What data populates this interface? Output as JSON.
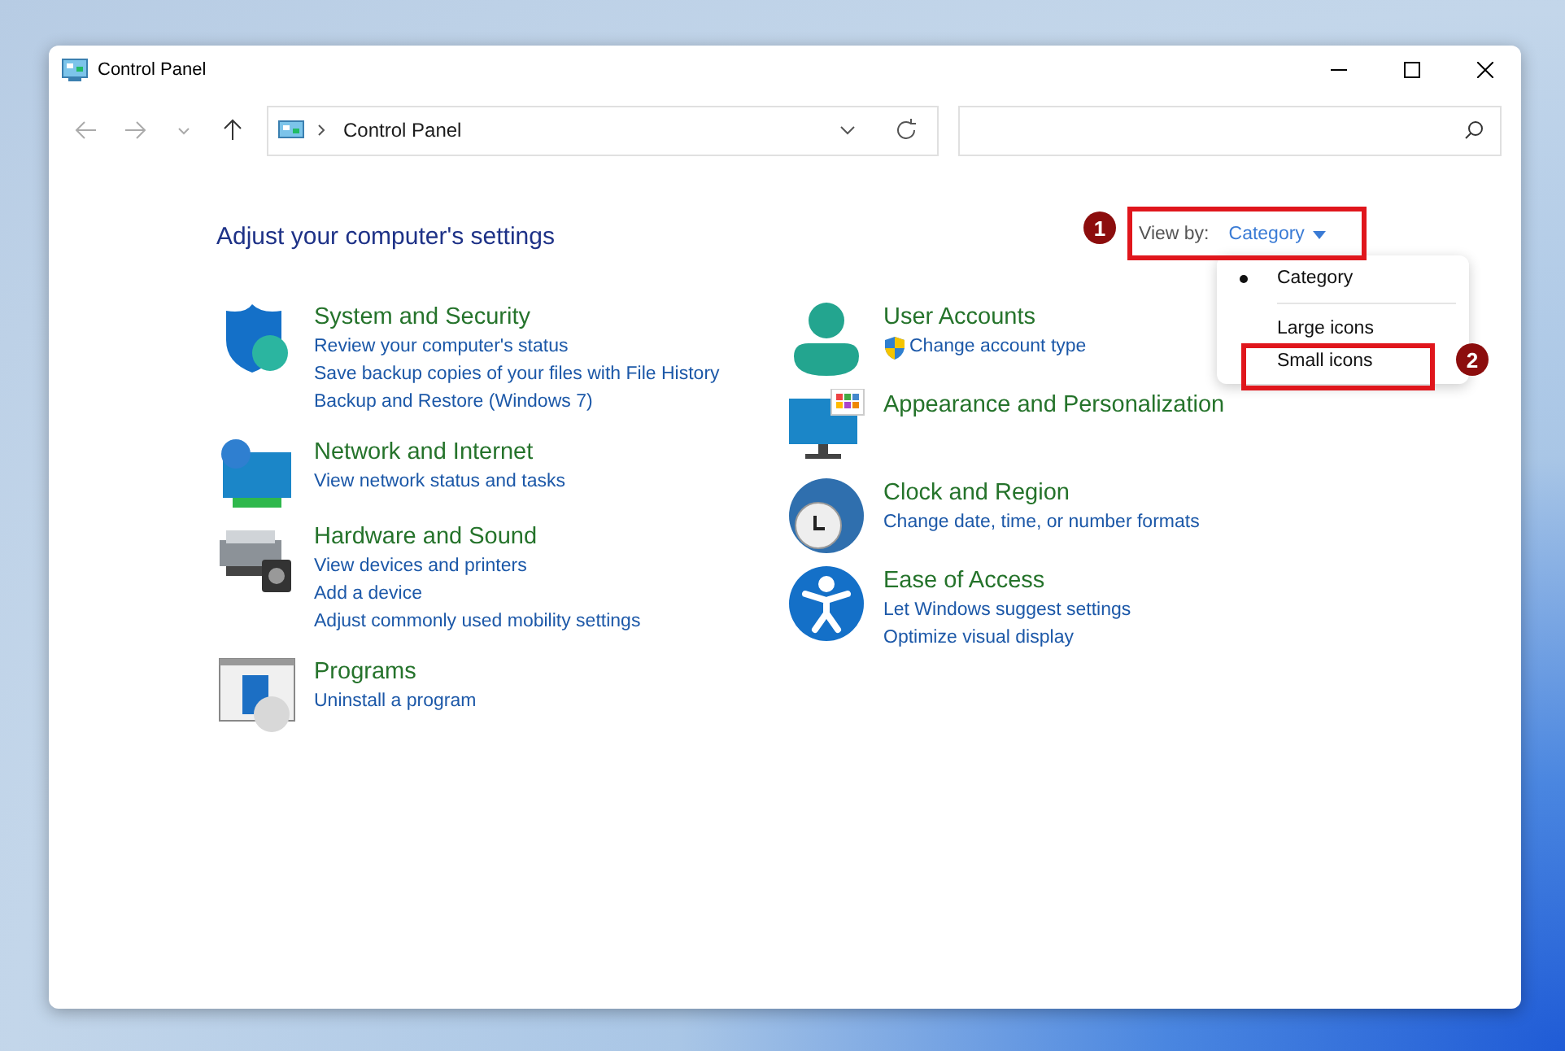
{
  "window": {
    "title": "Control Panel"
  },
  "address_bar": {
    "path": "Control Panel"
  },
  "heading": "Adjust your computer's settings",
  "view_by": {
    "label": "View by:",
    "value": "Category"
  },
  "view_menu": {
    "items": [
      {
        "label": "Category",
        "selected": true
      },
      {
        "label": "Large icons",
        "selected": false
      },
      {
        "label": "Small icons",
        "selected": false
      }
    ]
  },
  "annotations": [
    {
      "number": "1"
    },
    {
      "number": "2"
    }
  ],
  "categories_left": [
    {
      "kind": "security",
      "title": "System and Security",
      "links": [
        {
          "text": "Review your computer's status",
          "uac": false
        },
        {
          "text": "Save backup copies of your files with File History",
          "uac": false
        },
        {
          "text": "Backup and Restore (Windows 7)",
          "uac": false
        }
      ]
    },
    {
      "kind": "network",
      "title": "Network and Internet",
      "links": [
        {
          "text": "View network status and tasks",
          "uac": false
        }
      ]
    },
    {
      "kind": "hardware",
      "title": "Hardware and Sound",
      "links": [
        {
          "text": "View devices and printers",
          "uac": false
        },
        {
          "text": "Add a device",
          "uac": false
        },
        {
          "text": "Adjust commonly used mobility settings",
          "uac": false
        }
      ]
    },
    {
      "kind": "programs",
      "title": "Programs",
      "links": [
        {
          "text": "Uninstall a program",
          "uac": false
        }
      ]
    }
  ],
  "categories_right": [
    {
      "kind": "user",
      "title": "User Accounts",
      "links": [
        {
          "text": "Change account type",
          "uac": true
        }
      ]
    },
    {
      "kind": "appearance",
      "title": "Appearance and Personalization"
    },
    {
      "kind": "clock",
      "title": "Clock and Region",
      "links": [
        {
          "text": "Change date, time, or number formats",
          "uac": false
        }
      ]
    },
    {
      "kind": "access",
      "title": "Ease of Access",
      "links": [
        {
          "text": "Let Windows suggest settings",
          "uac": false
        },
        {
          "text": "Optimize visual display",
          "uac": false
        }
      ]
    }
  ]
}
